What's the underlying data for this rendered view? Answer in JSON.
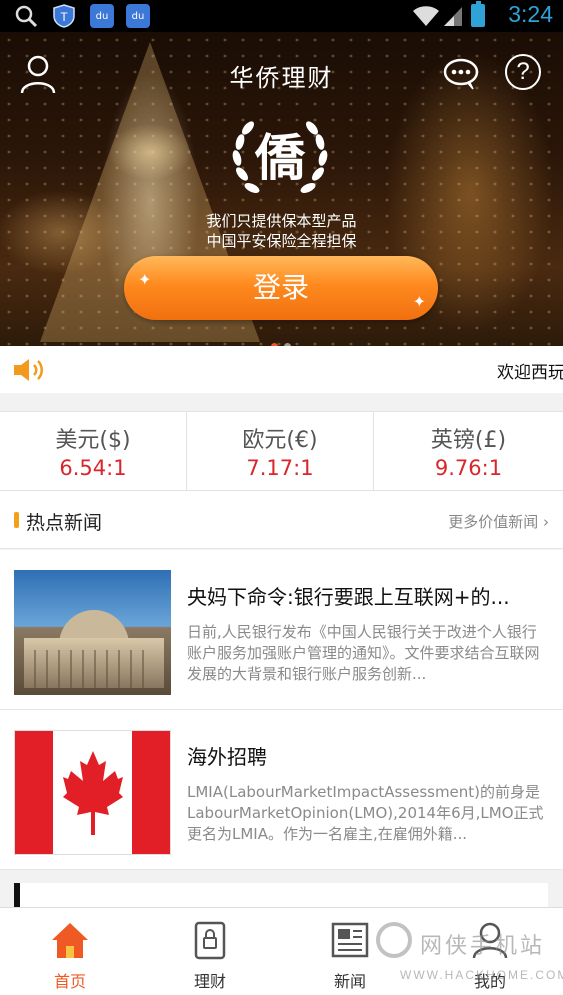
{
  "status_bar": {
    "time": "3:24",
    "baidu_label": "du"
  },
  "header": {
    "title": "华侨理财",
    "logo_char": "僑",
    "slogan_line1": "我们只提供保本型产品",
    "slogan_line2": "中国平安保险全程担保",
    "login_label": "登录",
    "carousel": {
      "count": 2,
      "active": 0
    }
  },
  "marquee": {
    "text": "欢迎西玩"
  },
  "rates": [
    {
      "name": "美元($)",
      "value": "6.54:1"
    },
    {
      "name": "欧元(€)",
      "value": "7.17:1"
    },
    {
      "name": "英镑(£)",
      "value": "9.76:1"
    }
  ],
  "news_section": {
    "title": "热点新闻",
    "more_label": "更多价值新闻 ›"
  },
  "news": [
    {
      "headline": "央妈下命令:银行要跟上互联网+的...",
      "summary": "日前,人民银行发布《中国人民银行关于改进个人银行账户服务加强账户管理的通知》。文件要求结合互联网发展的大背景和银行账户服务创新..."
    },
    {
      "headline": "海外招聘",
      "summary": "LMIA(LabourMarketImpactAssessment)的前身是LabourMarketOpinion(LMO),2014年6月,LMO正式更名为LMIA。作为一名雇主,在雇佣外籍..."
    }
  ],
  "bottom_nav": [
    {
      "label": "首页",
      "active": true
    },
    {
      "label": "理财",
      "active": false
    },
    {
      "label": "新闻",
      "active": false
    },
    {
      "label": "我的",
      "active": false
    }
  ],
  "watermark": {
    "text": "网侠手机站",
    "url": "WWW.HACKHOME.COM"
  },
  "colors": {
    "accent": "#ef5a24",
    "rate_red": "#d9262b",
    "button_orange": "#ff8a1e",
    "statusbar_blue": "#2fa3d8"
  }
}
